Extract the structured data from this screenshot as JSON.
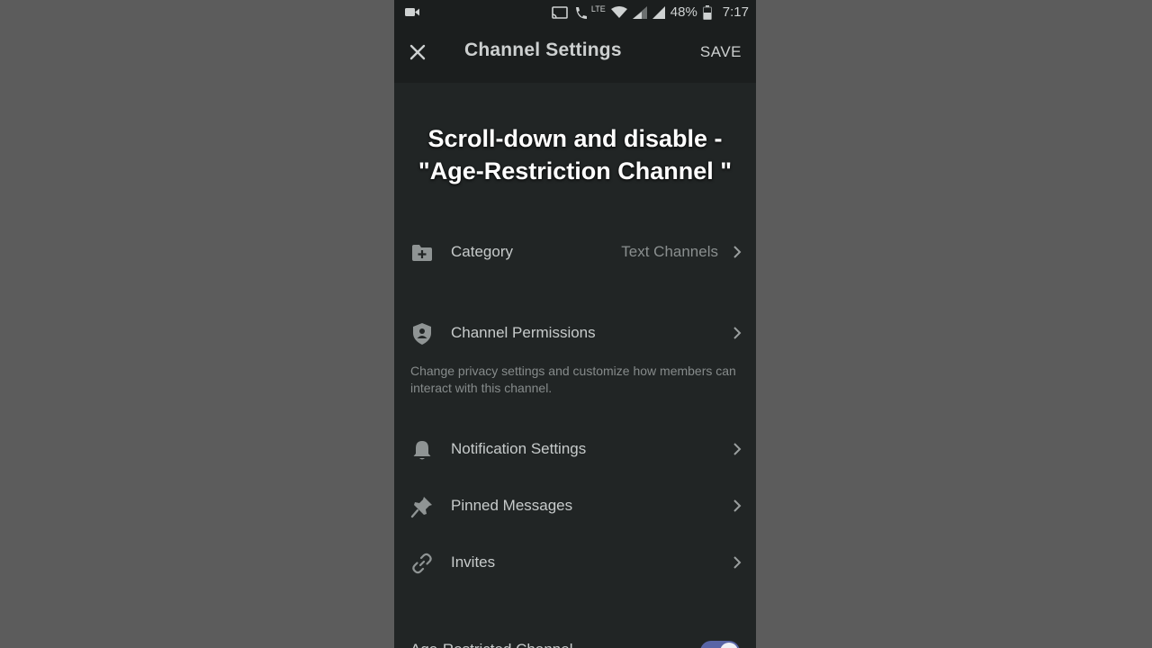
{
  "status_bar": {
    "battery": "48%",
    "time": "7:17",
    "network": "LTE"
  },
  "header": {
    "title": "Channel Settings",
    "save_label": "SAVE"
  },
  "overlay": {
    "line1": "Scroll-down and disable -",
    "line2": "\"Age-Restriction Channel \""
  },
  "settings": {
    "category": {
      "label": "Category",
      "value": "Text Channels",
      "icon": "folder-plus-icon"
    },
    "permissions": {
      "label": "Channel Permissions",
      "icon": "shield-user-icon",
      "description": "Change privacy settings and customize how members can interact with this channel."
    },
    "notifications": {
      "label": "Notification Settings",
      "icon": "bell-icon"
    },
    "pinned": {
      "label": "Pinned Messages",
      "icon": "pin-icon"
    },
    "invites": {
      "label": "Invites",
      "icon": "link-icon"
    },
    "age_restricted": {
      "label": "Age-Restricted Channel",
      "enabled": true
    }
  },
  "colors": {
    "background": "#212525",
    "header": "#1b1e1e",
    "toggle_on": "#5865a6"
  }
}
